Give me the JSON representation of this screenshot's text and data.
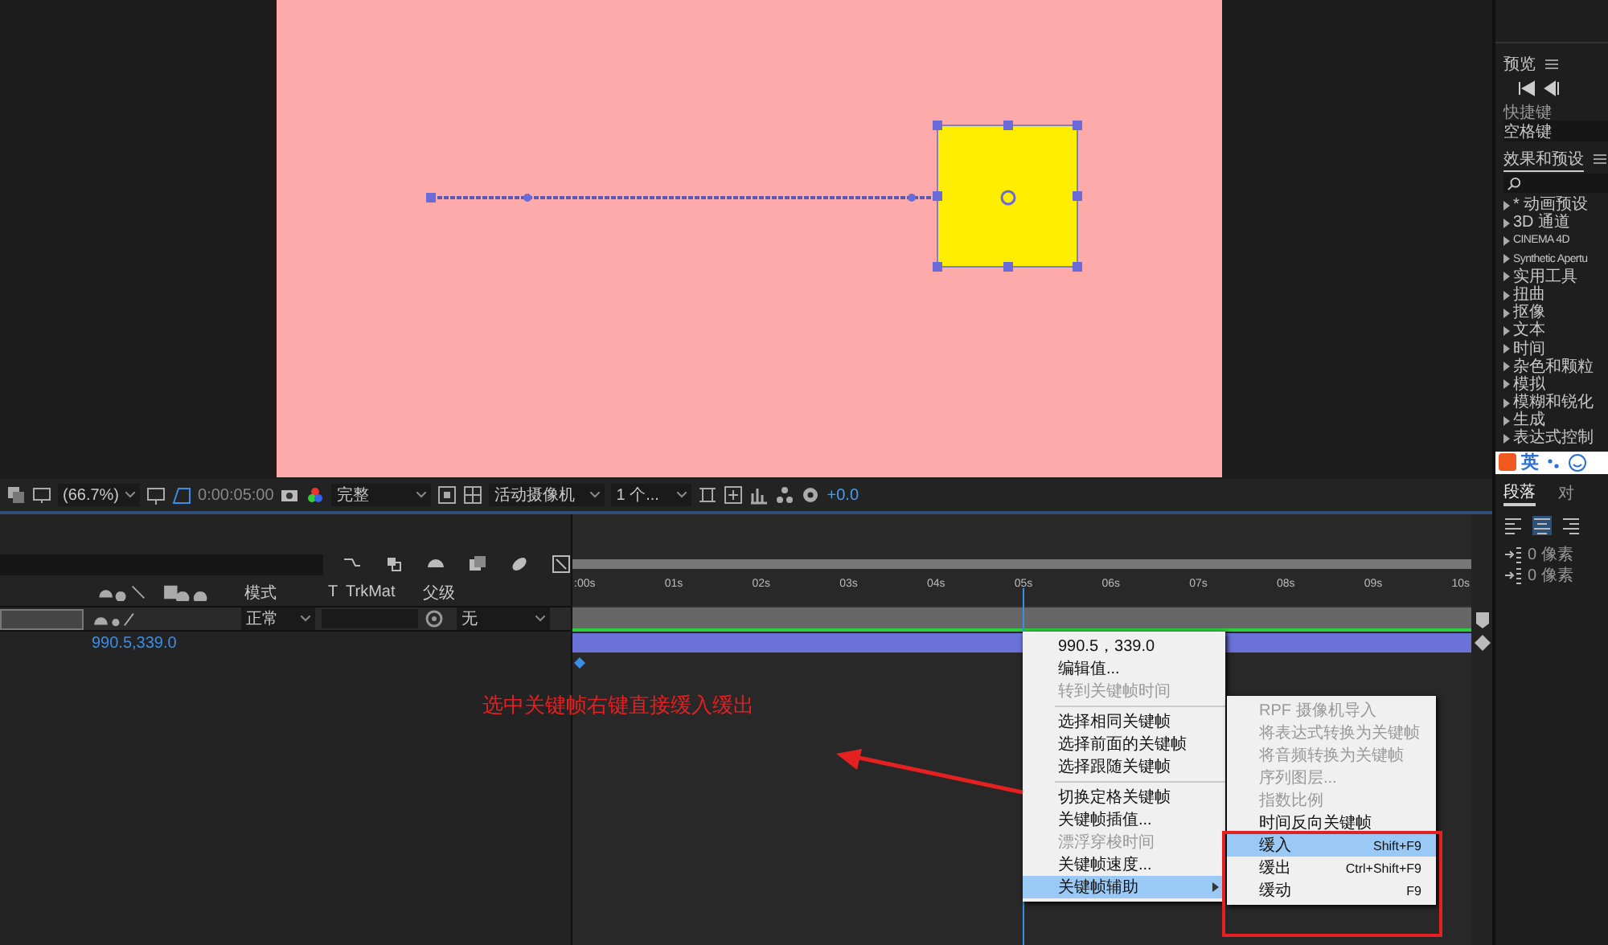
{
  "viewer": {
    "zoom": "(66.7%)",
    "timecode": "0:00:05:00",
    "resolution": "完整",
    "camera": "活动摄像机",
    "views": "1 个...",
    "exposure": "+0.0"
  },
  "timeline": {
    "columns": [
      {
        "label": "模式"
      },
      {
        "label": "T"
      },
      {
        "label": "TrkMat"
      },
      {
        "label": "父级"
      }
    ],
    "layer": {
      "mode": "正常",
      "parent": "无",
      "selected": true
    },
    "property_value": "990.5,339.0",
    "ruler": [
      ":00s",
      "01s",
      "02s",
      "03s",
      "04s",
      "05s",
      "06s",
      "07s",
      "08s",
      "09s",
      "10s"
    ],
    "playhead": {
      "level": 0.5
    }
  },
  "context_menu": {
    "items": [
      {
        "kind": "item",
        "label": "990.5，339.0",
        "disabled": false,
        "selected": false,
        "submenu": false
      },
      {
        "kind": "item",
        "label": "编辑值...",
        "disabled": false,
        "selected": false,
        "submenu": false
      },
      {
        "kind": "item",
        "label": "转到关键帧时间",
        "disabled": true,
        "selected": false,
        "submenu": false
      },
      {
        "kind": "separator"
      },
      {
        "kind": "item",
        "label": "选择相同关键帧",
        "disabled": false,
        "selected": false,
        "submenu": false
      },
      {
        "kind": "item",
        "label": "选择前面的关键帧",
        "disabled": false,
        "selected": false,
        "submenu": false
      },
      {
        "kind": "item",
        "label": "选择跟随关键帧",
        "disabled": false,
        "selected": false,
        "submenu": false
      },
      {
        "kind": "separator"
      },
      {
        "kind": "item",
        "label": "切换定格关键帧",
        "disabled": false,
        "selected": false,
        "submenu": false
      },
      {
        "kind": "item",
        "label": "关键帧插值...",
        "disabled": false,
        "selected": false,
        "submenu": false
      },
      {
        "kind": "item",
        "label": "漂浮穿梭时间",
        "disabled": true,
        "selected": false,
        "submenu": false
      },
      {
        "kind": "item",
        "label": "关键帧速度...",
        "disabled": false,
        "selected": false,
        "submenu": false
      },
      {
        "kind": "item",
        "label": "关键帧辅助",
        "disabled": false,
        "selected": true,
        "submenu": true
      }
    ]
  },
  "submenu": {
    "items": [
      {
        "label": "RPF 摄像机导入",
        "disabled": true,
        "selected": false
      },
      {
        "label": "将表达式转换为关键帧",
        "disabled": true,
        "selected": false
      },
      {
        "label": "将音频转换为关键帧",
        "disabled": true,
        "selected": false
      },
      {
        "label": "序列图层...",
        "disabled": true,
        "selected": false
      },
      {
        "label": "指数比例",
        "disabled": true,
        "selected": false
      },
      {
        "label": "时间反向关键帧",
        "disabled": false,
        "selected": false
      },
      {
        "label": "缓入",
        "shortcut": "Shift+F9",
        "disabled": false,
        "selected": true
      },
      {
        "label": "缓出",
        "shortcut": "Ctrl+Shift+F9",
        "disabled": false,
        "selected": false
      },
      {
        "label": "缓动",
        "shortcut": "F9",
        "disabled": false,
        "selected": false
      }
    ]
  },
  "annotation": {
    "text": "选中关键帧右键直接缓入缓出"
  },
  "right_panel": {
    "preview_title": "预览",
    "shortcut_label": "快捷键",
    "shortcut_value": "空格键",
    "effects_title": "效果和预设",
    "effects": [
      {
        "label": "* 动画预设"
      },
      {
        "label": "3D 通道"
      },
      {
        "label": "CINEMA 4D"
      },
      {
        "label": "Synthetic Apertu"
      },
      {
        "label": "实用工具"
      },
      {
        "label": "扭曲"
      },
      {
        "label": "抠像"
      },
      {
        "label": "文本"
      },
      {
        "label": "时间"
      },
      {
        "label": "杂色和颗粒"
      },
      {
        "label": "模拟"
      },
      {
        "label": "模糊和锐化"
      },
      {
        "label": "生成"
      },
      {
        "label": "表达式控制"
      }
    ],
    "ime": {
      "label": "英"
    },
    "tabs": [
      {
        "label": "段落",
        "selected": true
      },
      {
        "label": "对",
        "selected": false
      }
    ],
    "indents": [
      "0 像素",
      "0 像素"
    ]
  }
}
